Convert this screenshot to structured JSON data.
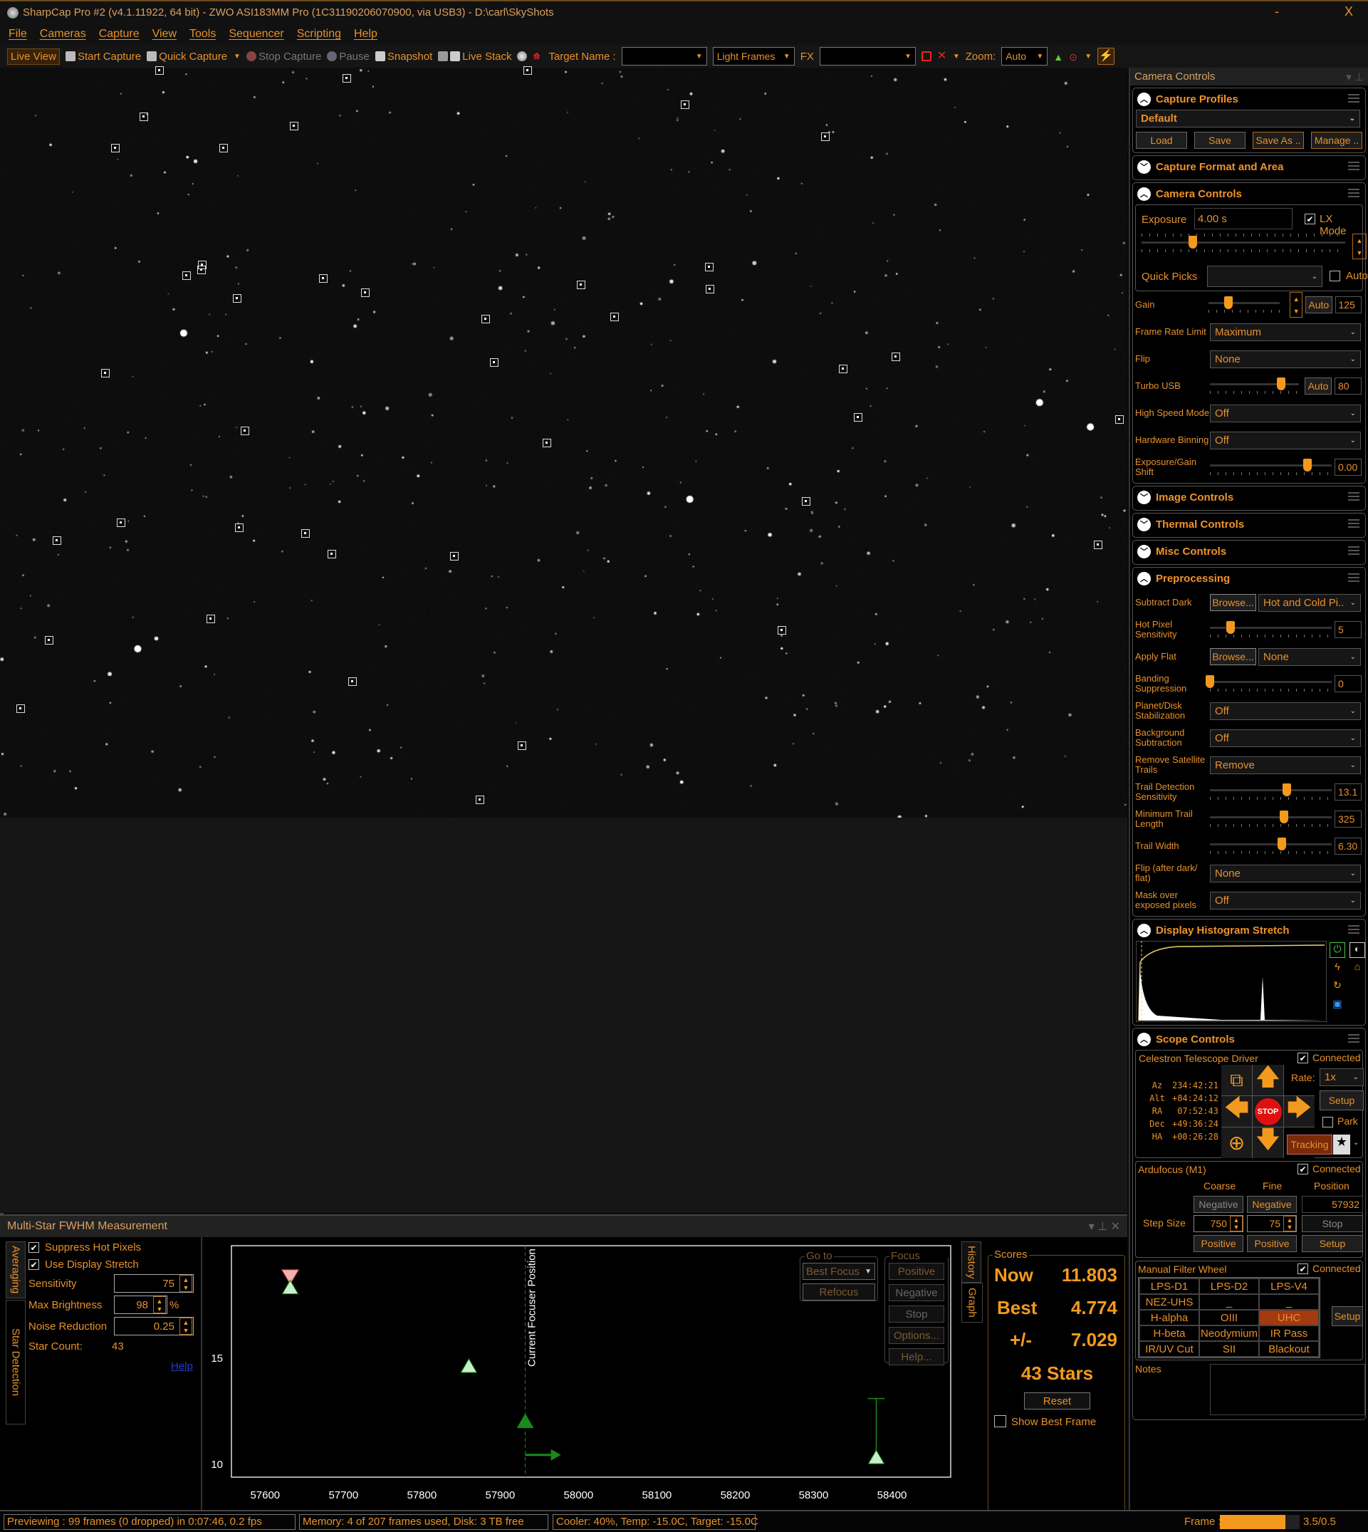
{
  "window": {
    "title": "SharpCap Pro #2 (v4.1.11922, 64 bit) - ZWO ASI183MM Pro (1C31190206070900, via USB3) - D:\\carl\\SkyShots",
    "minimize": "-",
    "close": "X"
  },
  "menu": [
    "File",
    "Cameras",
    "Capture",
    "View",
    "Tools",
    "Sequencer",
    "Scripting",
    "Help"
  ],
  "toolbar": {
    "live_view": "Live View",
    "start_capture": "Start Capture",
    "quick_capture": "Quick Capture",
    "stop_capture": "Stop Capture",
    "pause": "Pause",
    "snapshot": "Snapshot",
    "live_stack": "Live Stack",
    "target_name_label": "Target Name :",
    "target_name_value": "",
    "frame_type": "Light Frames",
    "fx_label": "FX",
    "fx_value": "",
    "zoom_label": "Zoom:",
    "zoom_value": "Auto"
  },
  "right_panel": {
    "title": "Camera Controls",
    "capture_profiles": {
      "title": "Capture Profiles",
      "selected": "Default",
      "buttons": [
        "Load",
        "Save",
        "Save As ..",
        "Manage .."
      ]
    },
    "capture_format": {
      "title": "Capture Format and Area"
    },
    "camera_controls": {
      "title": "Camera Controls",
      "exposure_label": "Exposure",
      "exposure_value": "4.00 s",
      "lx_mode_label": "LX Mode",
      "lx_mode_checked": true,
      "exposure_slider_level": 0.25,
      "quick_picks_label": "Quick Picks",
      "quick_picks_value": "",
      "auto_label": "Auto",
      "auto_checked": false,
      "rows": [
        {
          "label": "Gain",
          "type": "slider",
          "value": "125",
          "auto": "Auto",
          "level": 0.28,
          "spin": true
        },
        {
          "label": "Frame Rate Limit",
          "type": "select",
          "value": "Maximum"
        },
        {
          "label": "Flip",
          "type": "select",
          "value": "None"
        },
        {
          "label": "Turbo USB",
          "type": "slider",
          "value": "80",
          "auto": "Auto",
          "level": 0.8
        },
        {
          "label": "High Speed Mode",
          "type": "select",
          "value": "Off"
        },
        {
          "label": "Hardware Binning",
          "type": "select",
          "value": "Off"
        },
        {
          "label": "Exposure/Gain Shift",
          "type": "slider",
          "value": "0.00",
          "level": 0.8
        }
      ]
    },
    "image_controls": {
      "title": "Image Controls"
    },
    "thermal_controls": {
      "title": "Thermal Controls"
    },
    "misc_controls": {
      "title": "Misc Controls"
    },
    "preprocessing": {
      "title": "Preprocessing",
      "rows": [
        {
          "label": "Subtract Dark",
          "type": "browse",
          "browse": "Browse...",
          "value": "Hot and Cold Pi.."
        },
        {
          "label": "Hot Pixel Sensitivity",
          "type": "slider",
          "value": "5",
          "level": 0.17
        },
        {
          "label": "Apply Flat",
          "type": "browse",
          "browse": "Browse...",
          "value": "None"
        },
        {
          "label": "Banding Suppression",
          "type": "slider",
          "value": "0",
          "level": 0.0
        },
        {
          "label": "Planet/Disk Stabilization",
          "type": "select",
          "value": "Off"
        },
        {
          "label": "Background Subtraction",
          "type": "select",
          "value": "Off"
        },
        {
          "label": "Remove Satellite Trails",
          "type": "select",
          "value": "Remove"
        },
        {
          "label": "Trail Detection Sensitivity",
          "type": "slider",
          "value": "13.1",
          "level": 0.63
        },
        {
          "label": "Minimum Trail Length",
          "type": "slider",
          "value": "325",
          "level": 0.61
        },
        {
          "label": "Trail Width",
          "type": "slider",
          "value": "6.30",
          "level": 0.59
        },
        {
          "label": "Flip (after dark/ flat)",
          "type": "select",
          "value": "None"
        },
        {
          "label": "Mask over exposed pixels",
          "type": "select",
          "value": "Off"
        }
      ]
    },
    "histogram": {
      "title": "Display Histogram Stretch"
    },
    "scope": {
      "title": "Scope Controls",
      "driver": "Celestron Telescope Driver",
      "connected_label": "Connected",
      "connected": true,
      "coords": [
        {
          "k": "Az",
          "v": "234:42:21"
        },
        {
          "k": "Alt",
          "v": "+84:24:12"
        },
        {
          "k": "RA",
          "v": "07:52:43"
        },
        {
          "k": "Dec",
          "v": "+49:36:24"
        },
        {
          "k": "HA",
          "v": "+00:26:28"
        }
      ],
      "stop_label": "STOP",
      "rate_label": "Rate:",
      "rate_value": "1x",
      "setup": "Setup",
      "park_label": "Park",
      "park_checked": false,
      "tracking": "Tracking"
    },
    "focuser": {
      "title": "Ardufocus (M1)",
      "connected_label": "Connected",
      "connected": true,
      "coarse": "Coarse",
      "fine": "Fine",
      "position_label": "Position",
      "position": "57932",
      "step_size_label": "Step Size",
      "coarse_step": "750",
      "fine_step": "75",
      "negative": "Negative",
      "positive": "Positive",
      "stop": "Stop",
      "setup": "Setup"
    },
    "filter_wheel": {
      "title": "Manual Filter Wheel",
      "connected_label": "Connected",
      "connected": true,
      "filters": [
        "LPS-D1",
        "LPS-D2",
        "LPS-V4",
        "NEZ-UHS",
        "_",
        "_",
        "H-alpha",
        "OIII",
        "UHC",
        "H-beta",
        "Neodymium",
        "IR Pass",
        "IR/UV Cut",
        "SII",
        "Blackout"
      ],
      "selected": "UHC",
      "setup": "Setup"
    },
    "notes": {
      "label": "Notes",
      "value": ""
    }
  },
  "fwhm": {
    "title": "Multi-Star FWHM Measurement",
    "tabs": [
      "Averaging",
      "Star Detection"
    ],
    "suppress_hot_pixels": {
      "label": "Suppress Hot Pixels",
      "checked": true
    },
    "use_display_stretch": {
      "label": "Use Display Stretch",
      "checked": true
    },
    "sensitivity": {
      "label": "Sensitivity",
      "value": "75"
    },
    "max_brightness": {
      "label": "Max Brightness",
      "value": "98",
      "unit": "%"
    },
    "noise_reduction": {
      "label": "Noise Reduction",
      "value": "0.25"
    },
    "star_count": {
      "label": "Star Count:",
      "value": "43"
    },
    "help": "Help",
    "goto": {
      "legend": "Go to",
      "value": "Best Focus",
      "refocus": "Refocus"
    },
    "focus_scan": {
      "legend": "Focus Scan",
      "buttons": [
        "Positive",
        "Negative",
        "Stop",
        "Options...",
        "Help..."
      ]
    },
    "side_tabs": [
      "History",
      "Graph"
    ],
    "scores": {
      "legend": "Scores",
      "now_label": "Now",
      "now": "11.803",
      "best_label": "Best",
      "best": "4.774",
      "pm_label": "+/-",
      "pm": "7.029",
      "stars": "43 Stars",
      "reset": "Reset",
      "show_best_frame": "Show Best Frame",
      "show_best_checked": false
    },
    "graph": {
      "current_position_label": "Current Focuser Position",
      "current_position": 57932,
      "x_ticks": [
        57600,
        57700,
        57800,
        57900,
        58000,
        58100,
        58200,
        58300,
        58400
      ],
      "y_ticks": [
        10,
        15
      ],
      "xlim": [
        57557,
        58475
      ],
      "ylim": [
        9.4,
        20.3
      ],
      "points": [
        {
          "x": 57632,
          "y": 18.3
        },
        {
          "x": 57860,
          "y": 14.6
        },
        {
          "x": 57932,
          "y": 12.0
        },
        {
          "x": 58380,
          "y": 10.3,
          "err_top": 13.1
        }
      ],
      "best_marker": {
        "x": 57632,
        "y": 18.9
      },
      "colors": {
        "point": "#c8f0c8",
        "best": "#f0b0b0",
        "line": "#1a8a1a"
      }
    }
  },
  "status": {
    "preview": "Previewing : 99 frames (0 dropped) in 0:07:46, 0.2 fps",
    "memory": "Memory: 4 of 207 frames used, Disk: 3 TB free",
    "cooler": "Cooler: 40%, Temp: -15.0C, Target: -15.0C",
    "frame_label": "Frame :",
    "frame_value": "3.5/0.5",
    "frame_progress": 0.82
  },
  "colors": {
    "accent": "#e8912a",
    "selected_filter": "#a33a10",
    "stop": "#e01010"
  }
}
